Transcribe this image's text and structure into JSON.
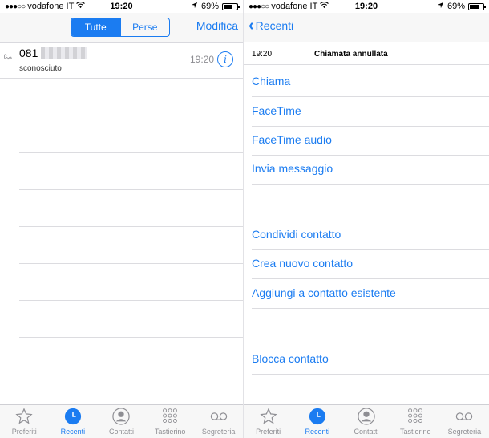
{
  "status": {
    "carrier": "vodafone IT",
    "time": "19:20",
    "battery": "69%",
    "battery_level": 0.69
  },
  "left": {
    "segments": [
      "Tutte",
      "Perse"
    ],
    "edit_label": "Modifica",
    "call": {
      "number": "081",
      "label": "sconosciuto",
      "time": "19:20"
    }
  },
  "right": {
    "back_label": "Recenti",
    "detail": {
      "time": "19:20",
      "type": "Chiamata annullata"
    },
    "actions": [
      "Chiama",
      "FaceTime",
      "FaceTime audio",
      "Invia messaggio"
    ],
    "contact_actions": [
      "Condividi contatto",
      "Crea nuovo contatto",
      "Aggiungi a contatto esistente"
    ],
    "block_label": "Blocca contatto"
  },
  "tabs": [
    {
      "label": "Preferiti",
      "icon": "star-icon"
    },
    {
      "label": "Recenti",
      "icon": "clock-icon"
    },
    {
      "label": "Contatti",
      "icon": "person-icon"
    },
    {
      "label": "Tastierino",
      "icon": "keypad-icon"
    },
    {
      "label": "Segreteria",
      "icon": "voicemail-icon"
    }
  ],
  "colors": {
    "accent": "#1b7cf1",
    "gray": "#8e8e93"
  }
}
